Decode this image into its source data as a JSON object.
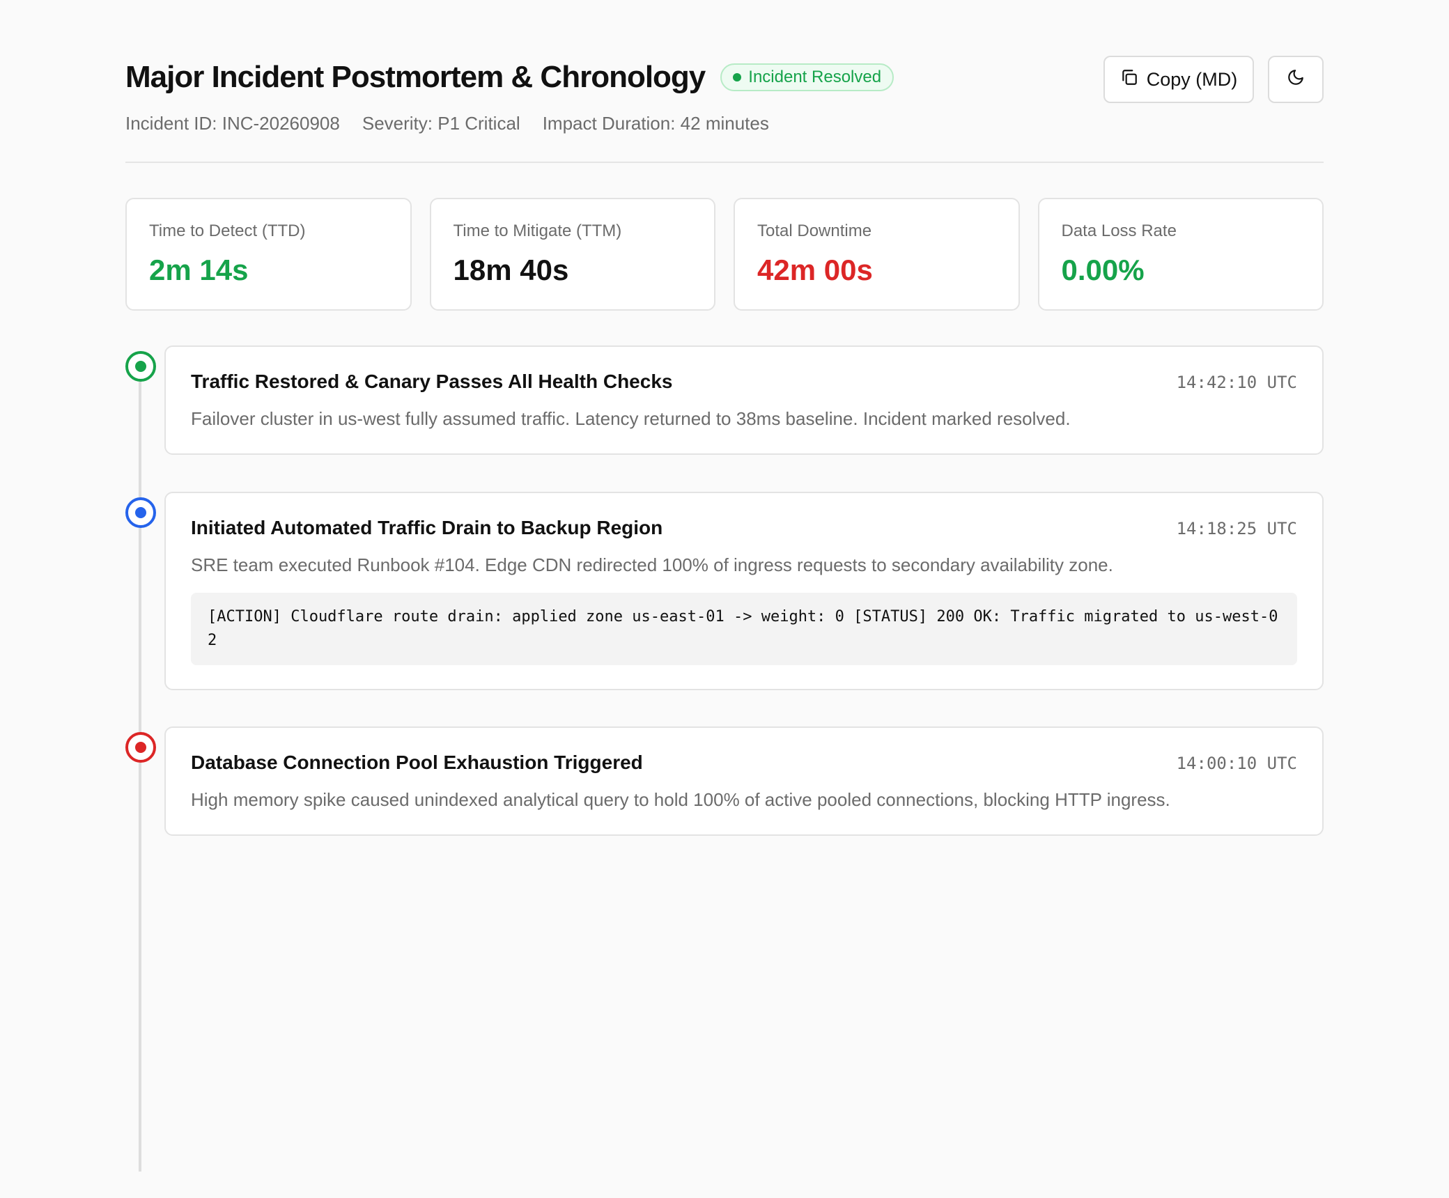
{
  "header": {
    "title": "Major Incident Postmortem & Chronology",
    "status_badge": "Incident Resolved",
    "meta": {
      "incident_id": "Incident ID: INC-20260908",
      "severity": "Severity: P1 Critical",
      "impact_duration": "Impact Duration: 42 minutes"
    },
    "actions": {
      "copy_label": "Copy (MD)",
      "copy_icon": "copy-icon",
      "theme_icon": "moon-icon"
    }
  },
  "stats": [
    {
      "label": "Time to Detect (TTD)",
      "value": "2m 14s",
      "color": "#16a34a"
    },
    {
      "label": "Time to Mitigate (TTM)",
      "value": "18m 40s",
      "color": "#111111"
    },
    {
      "label": "Total Downtime",
      "value": "42m 00s",
      "color": "#dc2626"
    },
    {
      "label": "Data Loss Rate",
      "value": "0.00%",
      "color": "#16a34a"
    }
  ],
  "timeline": [
    {
      "title": "Traffic Restored & Canary Passes All Health Checks",
      "time": "14:42:10 UTC",
      "description": "Failover cluster in us-west fully assumed traffic. Latency returned to 38ms baseline. Incident marked resolved.",
      "marker_color": "#16a34a"
    },
    {
      "title": "Initiated Automated Traffic Drain to Backup Region",
      "time": "14:18:25 UTC",
      "description": "SRE team executed Runbook #104. Edge CDN redirected 100% of ingress requests to secondary availability zone.",
      "code": "[ACTION] Cloudflare route drain: applied zone us-east-01 -> weight: 0 [STATUS] 200 OK: Traffic migrated to us-west-02",
      "marker_color": "#2563eb"
    },
    {
      "title": "Database Connection Pool Exhaustion Triggered",
      "time": "14:00:10 UTC",
      "description": "High memory spike caused unindexed analytical query to hold 100% of active pooled connections, blocking HTTP ingress.",
      "marker_color": "#dc2626"
    }
  ],
  "colors": {
    "success": "#16a34a",
    "info": "#2563eb",
    "danger": "#dc2626",
    "muted_text": "#6b6b6b"
  }
}
